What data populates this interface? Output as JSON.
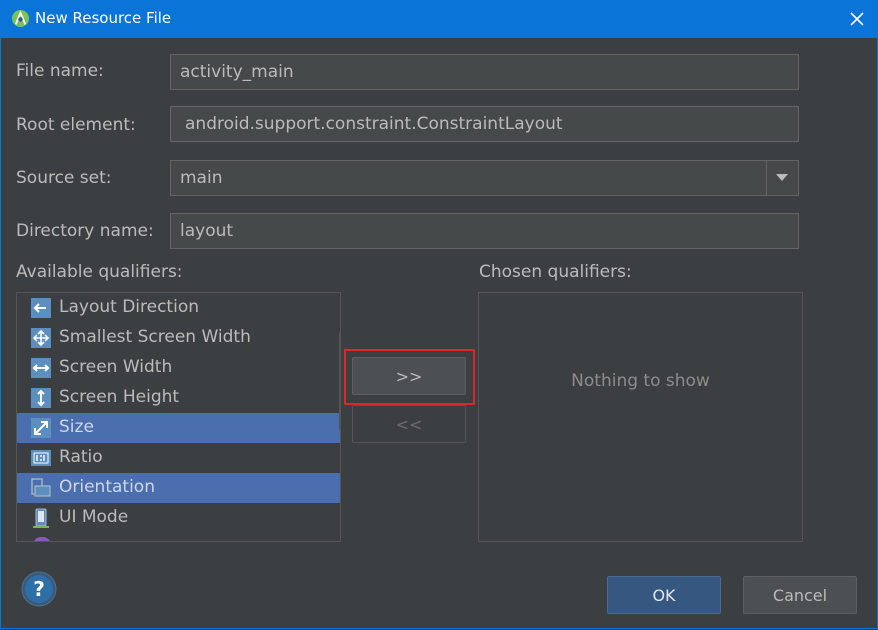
{
  "window": {
    "title": "New Resource File",
    "close_icon": "close-icon",
    "app_icon": "android-studio-icon"
  },
  "form": {
    "file_name_label": "File name:",
    "file_name_value": "activity_main",
    "root_element_label": "Root element:",
    "root_element_value": "android.support.constraint.ConstraintLayout",
    "source_set_label": "Source set:",
    "source_set_value": "main",
    "directory_label": "Directory name:",
    "directory_value": "layout"
  },
  "available": {
    "label": "Available qualifiers:",
    "items": [
      {
        "label": "Layout Direction",
        "icon": "layout-direction-icon",
        "selected": false
      },
      {
        "label": "Smallest Screen Width",
        "icon": "smallest-screen-width-icon",
        "selected": false
      },
      {
        "label": "Screen Width",
        "icon": "screen-width-icon",
        "selected": false
      },
      {
        "label": "Screen Height",
        "icon": "screen-height-icon",
        "selected": false
      },
      {
        "label": "Size",
        "icon": "size-icon",
        "selected": true
      },
      {
        "label": "Ratio",
        "icon": "ratio-icon",
        "selected": false
      },
      {
        "label": "Orientation",
        "icon": "orientation-icon",
        "selected": true
      },
      {
        "label": "UI Mode",
        "icon": "ui-mode-icon",
        "selected": false
      }
    ]
  },
  "chosen": {
    "label": "Chosen qualifiers:",
    "empty_text": "Nothing to show"
  },
  "transfer": {
    "add_label": ">>",
    "remove_label": "<<"
  },
  "footer": {
    "ok_label": "OK",
    "cancel_label": "Cancel",
    "help_label": "?"
  },
  "colors": {
    "titlebar": "#0a74d8",
    "background": "#3c3f41",
    "selection": "#4b6eaf",
    "highlight": "#e0252b"
  }
}
